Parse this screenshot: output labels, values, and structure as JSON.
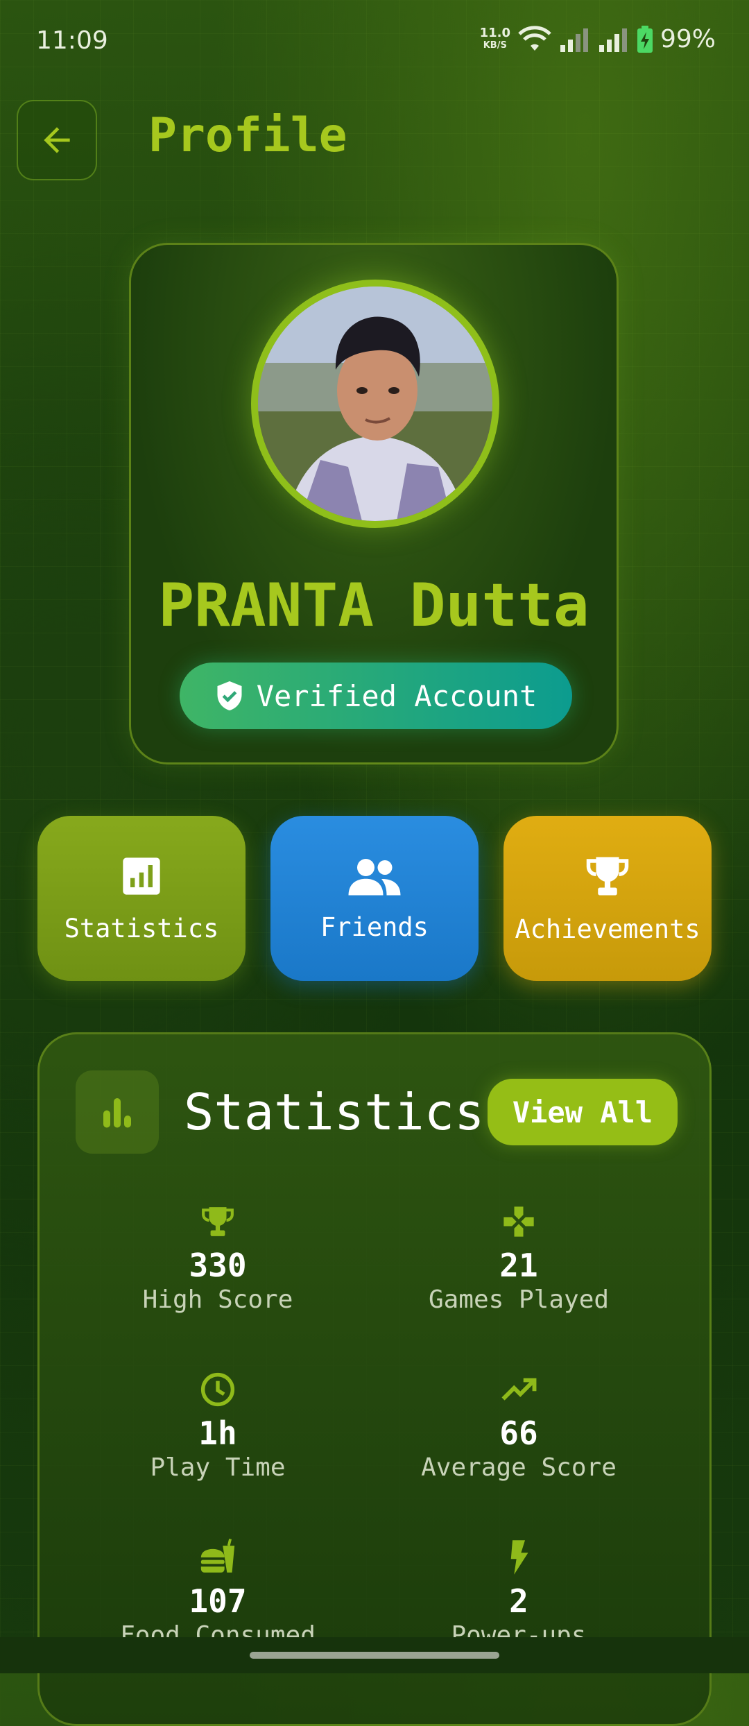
{
  "status_bar": {
    "time": "11:09",
    "net_speed_value": "11.0",
    "net_speed_unit": "KB/S",
    "battery": "99%"
  },
  "header": {
    "title": "Profile",
    "back_icon": "arrow-left-icon"
  },
  "profile": {
    "name": "PRANTA Dutta",
    "verified_label": "Verified Account"
  },
  "quick_actions": [
    {
      "label": "Statistics",
      "icon": "bar-chart-icon",
      "color": "#7ea01a"
    },
    {
      "label": "Friends",
      "icon": "people-icon",
      "color": "#2285d8"
    },
    {
      "label": "Achievements",
      "icon": "trophy-icon",
      "color": "#d9a60f"
    }
  ],
  "statistics": {
    "title": "Statistics",
    "view_all": "View All",
    "items": [
      {
        "value": "330",
        "label": "High Score",
        "icon": "trophy-icon"
      },
      {
        "value": "21",
        "label": "Games Played",
        "icon": "gamepad-icon"
      },
      {
        "value": "1h",
        "label": "Play Time",
        "icon": "clock-icon"
      },
      {
        "value": "66",
        "label": "Average Score",
        "icon": "trending-up-icon"
      },
      {
        "value": "107",
        "label": "Food Consumed",
        "icon": "fastfood-icon"
      },
      {
        "value": "2",
        "label": "Power-ups",
        "icon": "bolt-icon"
      }
    ]
  },
  "colors": {
    "accent": "#a6c81e",
    "background": "#1f440d"
  }
}
